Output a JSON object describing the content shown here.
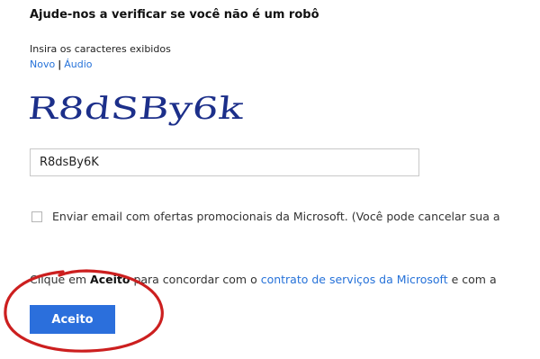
{
  "heading": "Ajude-nos a verificar se você não é um robô",
  "captcha": {
    "label": "Insira os caracteres exibidos",
    "new_link": "Novo",
    "separator": "|",
    "audio_link": "Áudio",
    "image_text": "R8dSBy6k",
    "input_value": "R8dsBy6K"
  },
  "promo": {
    "checked": false,
    "text": "Enviar email com ofertas promocionais da Microsoft. (Você pode cancelar sua a"
  },
  "terms": {
    "prefix": "Clique em ",
    "accept_word": "Aceito",
    "middle": " para concordar com o ",
    "link": "contrato de serviços da Microsoft",
    "suffix": " e com a"
  },
  "accept_button": "Aceito",
  "colors": {
    "link": "#2672d9",
    "button": "#2b6fdc",
    "annotation": "#cc1f1f"
  },
  "annotation": "red-circle-highlight"
}
